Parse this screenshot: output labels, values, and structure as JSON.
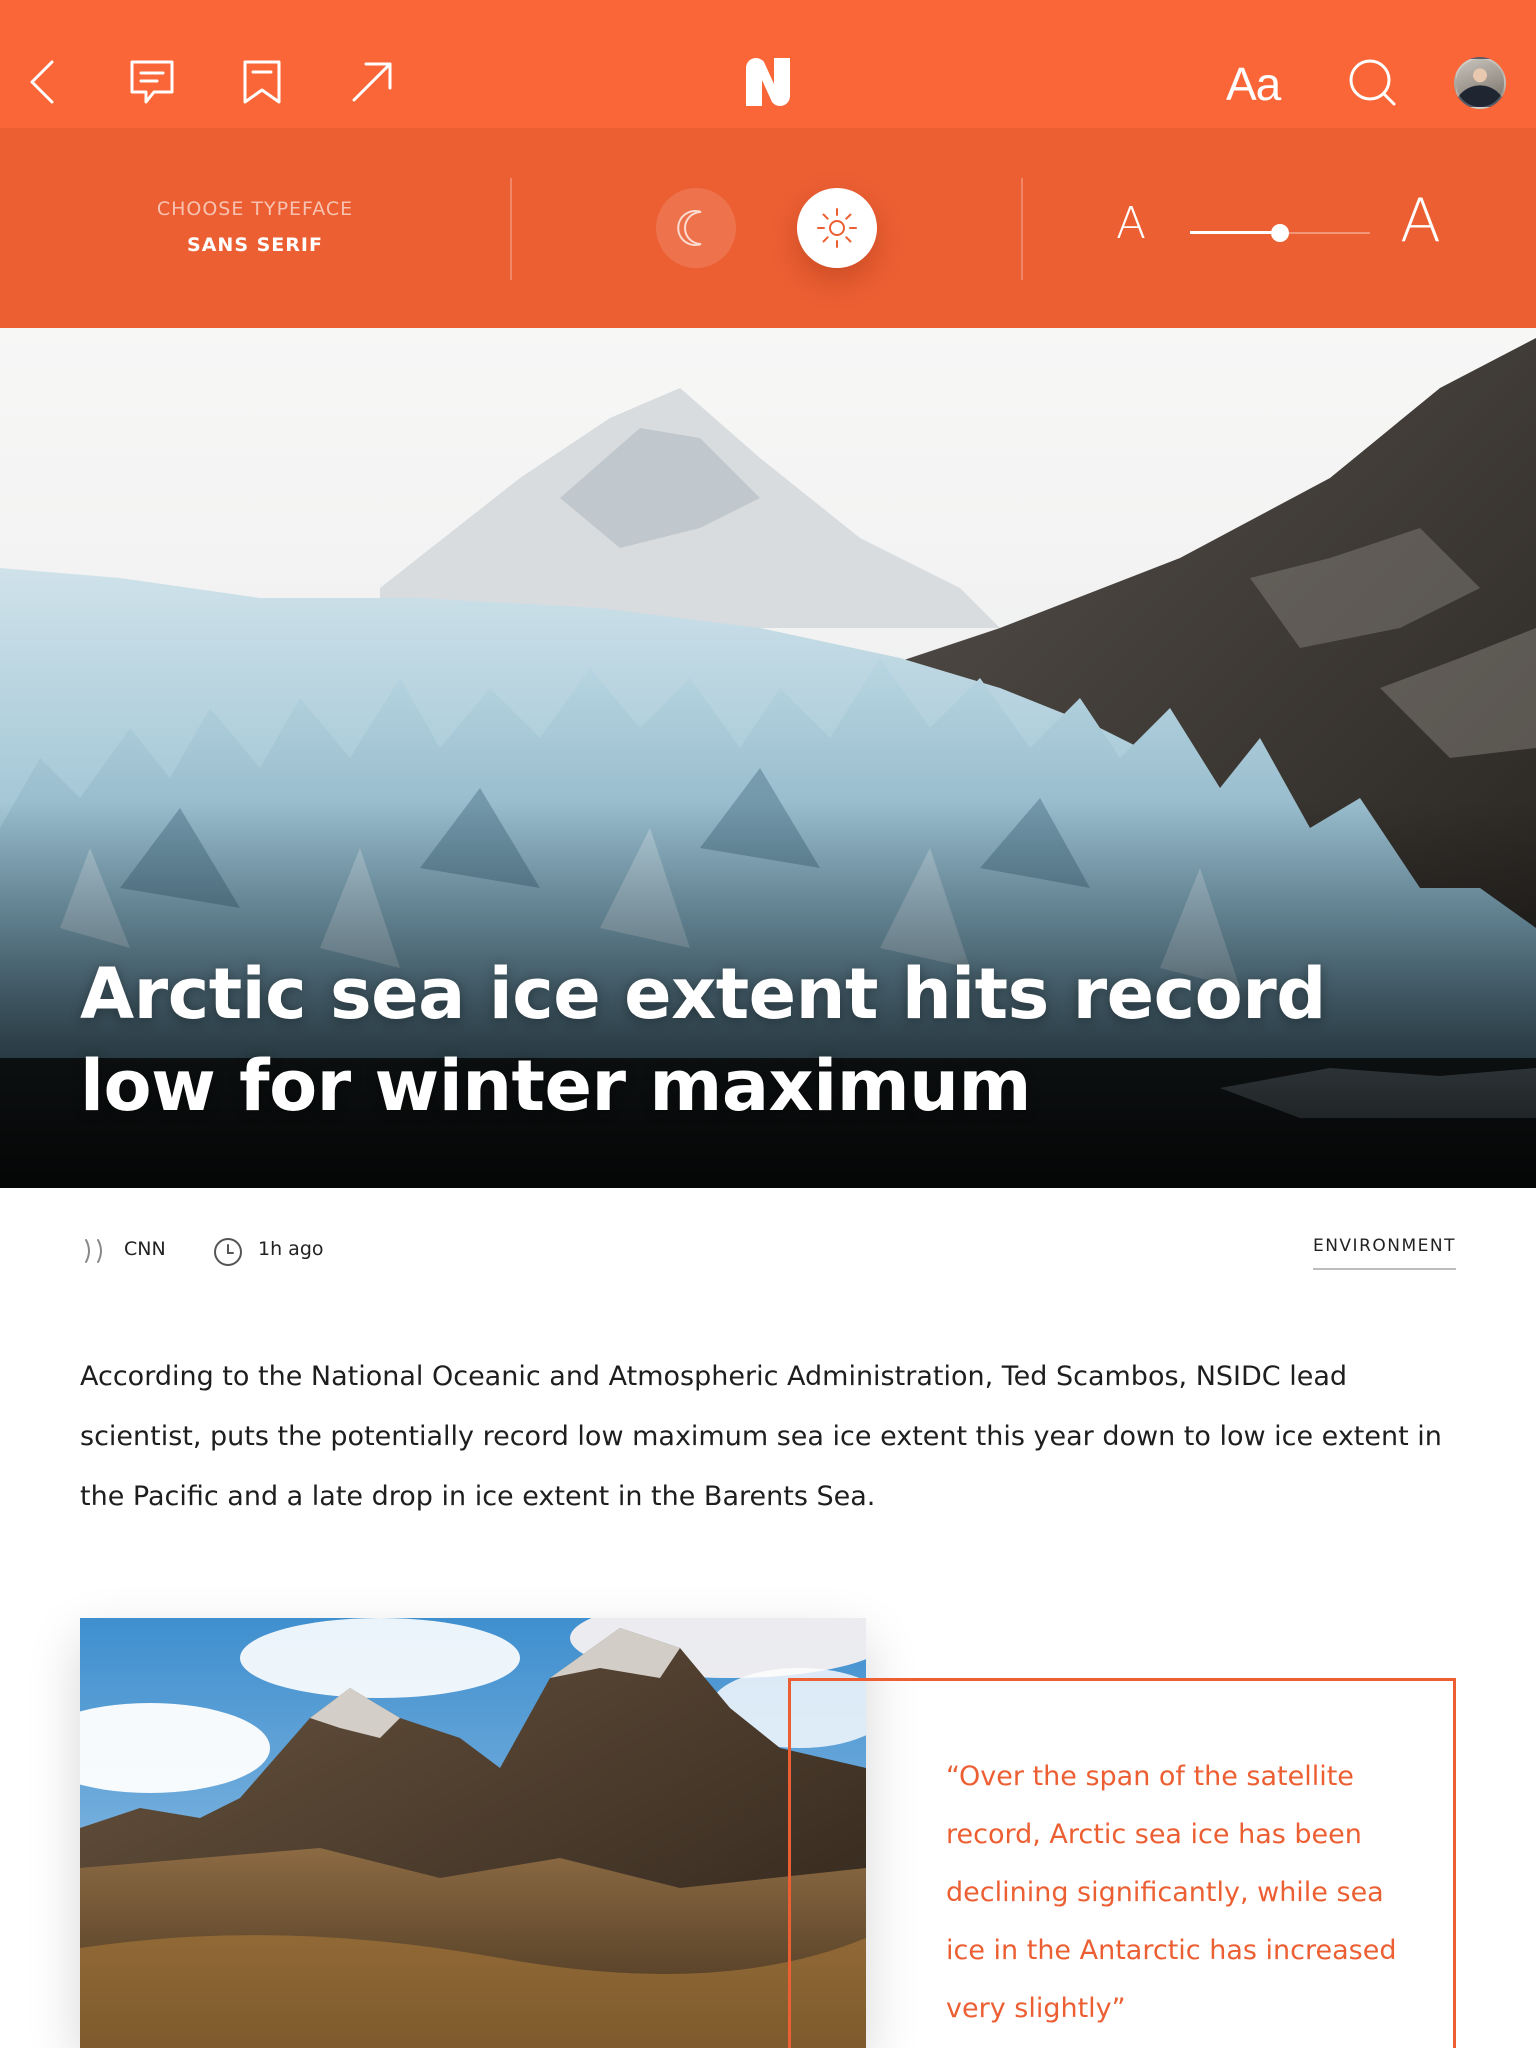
{
  "nav": {
    "back_icon": "chevron-left-icon",
    "comments_icon": "comment-icon",
    "bookmark_icon": "bookmark-icon",
    "share_icon": "share-arrow-icon",
    "logo_icon": "n-logo",
    "text_settings_label": "Aa",
    "search_icon": "search-icon",
    "avatar": "user-avatar"
  },
  "reading_settings": {
    "typeface_label": "CHOOSE TYPEFACE",
    "typeface_value": "SANS SERIF",
    "dark_mode_icon": "moon-icon",
    "light_mode_icon": "sun-icon",
    "active_mode": "light",
    "font_size_small_label": "A",
    "font_size_large_label": "A",
    "font_size_level": 0.5
  },
  "article": {
    "title": "Arctic sea ice extent hits record low for winter maximum",
    "source": "CNN",
    "time": "1h ago",
    "category": "ENVIRONMENT",
    "body": "According to the National Oceanic and Atmospheric Administration, Ted Scambos, NSIDC lead scientist, puts the potentially record low maximum sea ice extent this year down to low ice extent in the Pacific and a late drop in ice extent in the Barents Sea.",
    "pull_quote": "“Over the span of the satellite record, Arctic sea ice has been declining significantly, while sea ice in the Antarctic has increased very slightly”"
  },
  "colors": {
    "accent": "#fa6637",
    "accent_dark": "#ec5f33",
    "text": "#1e1e1e"
  }
}
